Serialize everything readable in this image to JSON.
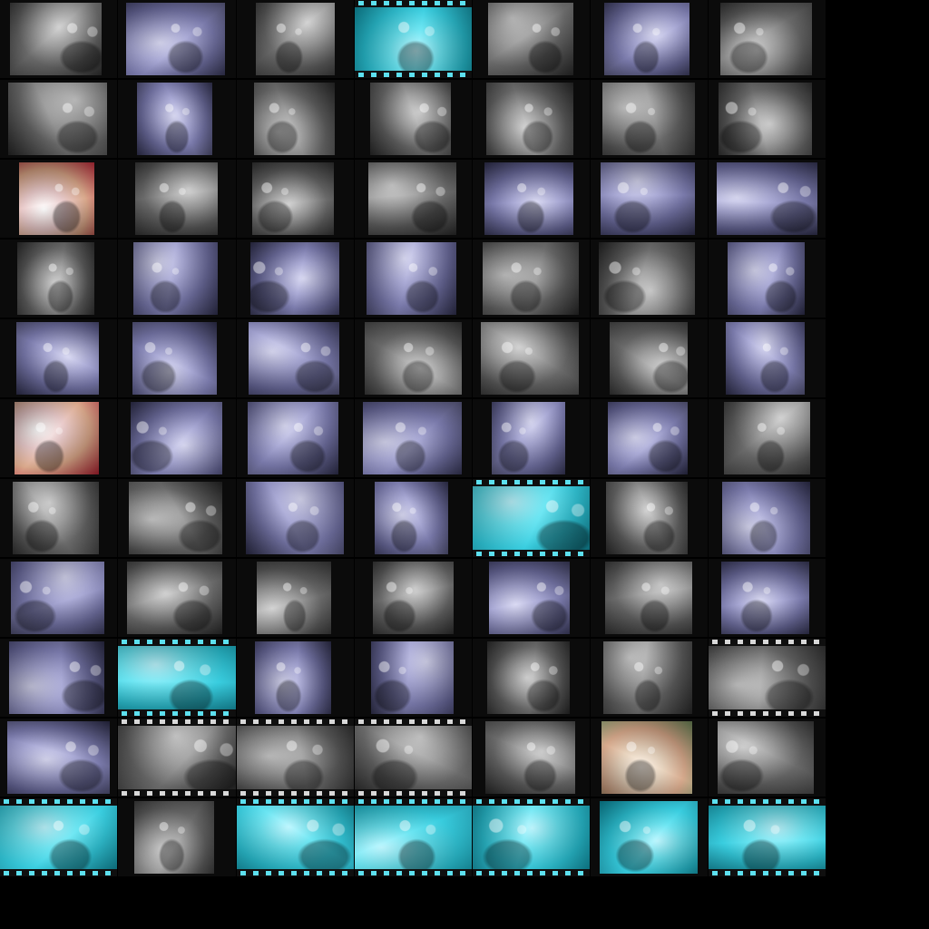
{
  "contact_sheet": {
    "rows": [
      [
        "gray",
        "lav",
        "gray",
        "cyan-b",
        "gray",
        "lav",
        "gray"
      ],
      [
        "gray",
        "lav",
        "gray",
        "gray",
        "gray",
        "gray",
        "gray"
      ],
      [
        "color",
        "gray",
        "gray",
        "gray",
        "lav",
        "lav",
        "lav"
      ],
      [
        "gray",
        "lav",
        "lav",
        "lav",
        "gray",
        "gray",
        "lav"
      ],
      [
        "lav",
        "lav",
        "lav",
        "gray",
        "gray",
        "gray",
        "lav"
      ],
      [
        "color",
        "lav",
        "lav",
        "lav",
        "lav",
        "lav",
        "gray"
      ],
      [
        "gray",
        "gray",
        "lav",
        "lav",
        "cyan-b",
        "gray",
        "lav"
      ],
      [
        "lav",
        "gray",
        "gray",
        "gray",
        "lav",
        "gray",
        "lav"
      ],
      [
        "lav",
        "cyan-b",
        "lav",
        "lav",
        "gray",
        "gray",
        "gray-b"
      ],
      [
        "lav",
        "gray-b",
        "gray-b",
        "gray-b",
        "gray",
        "color-warm",
        "gray"
      ],
      [
        "cyan-b",
        "gray",
        "cyan-b",
        "cyan-b",
        "cyan-b",
        "cyan",
        "cyan-b"
      ]
    ],
    "colors": {
      "sheet_background": "#000000",
      "film_cyan": "#35d6e6",
      "lavender_tint": "#8c8cc4",
      "gray_tint": "#8a8a8a"
    }
  }
}
